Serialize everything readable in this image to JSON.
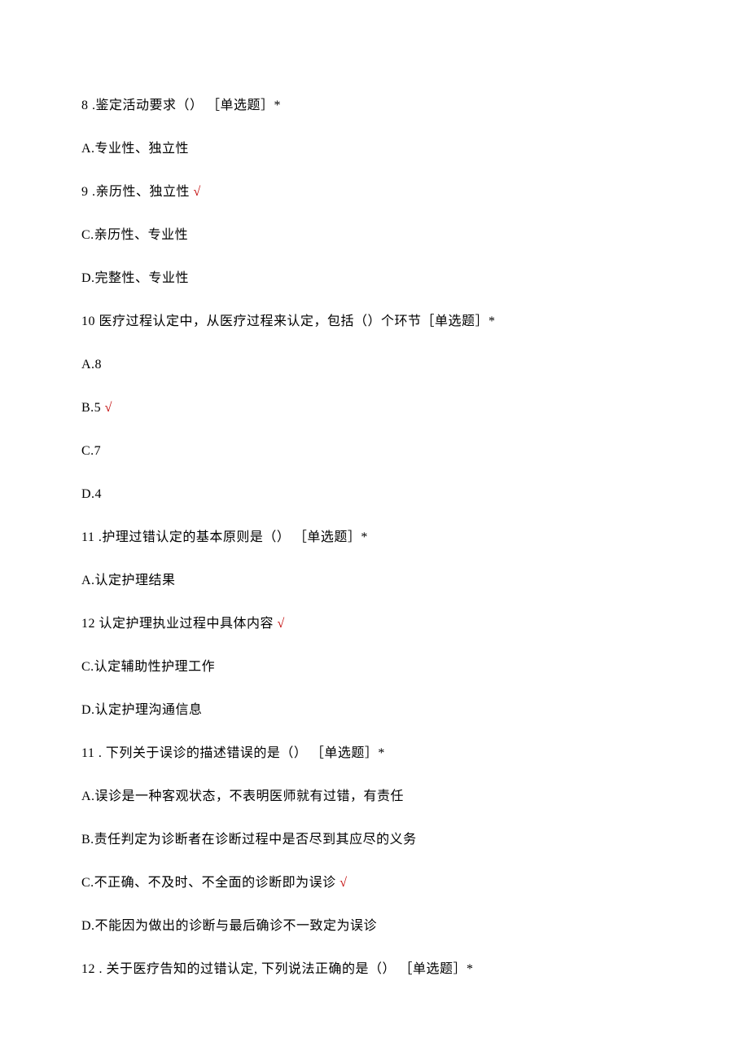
{
  "questions": [
    {
      "number": "8",
      "suffix": "   .鉴定活动要求（） ［单选题］*",
      "options": [
        {
          "label": "A.专业性、独立性",
          "correct": false,
          "prefix": ""
        },
        {
          "label": ".亲历性、独立性",
          "prefix": "9   ",
          "correct": true
        },
        {
          "label": "C.亲历性、专业性",
          "correct": false,
          "prefix": ""
        },
        {
          "label": "D.完整性、专业性",
          "correct": false,
          "prefix": ""
        }
      ]
    },
    {
      "number": "10",
      "suffix": "  医疗过程认定中，从医疗过程来认定，包括（）个环节［单选题］*",
      "options": [
        {
          "label": "A.8",
          "correct": false,
          "prefix": ""
        },
        {
          "label": "B.5",
          "correct": true,
          "prefix": ""
        },
        {
          "label": "C.7",
          "correct": false,
          "prefix": ""
        },
        {
          "label": "D.4",
          "correct": false,
          "prefix": ""
        }
      ]
    },
    {
      "number": "11",
      "suffix": "   .护理过错认定的基本原则是（） ［单选题］*",
      "options": [
        {
          "label": "A.认定护理结果",
          "correct": false,
          "prefix": ""
        },
        {
          "label": "认定护理执业过程中具体内容",
          "prefix": "12  ",
          "correct": true
        },
        {
          "label": "C.认定辅助性护理工作",
          "correct": false,
          "prefix": ""
        },
        {
          "label": "D.认定护理沟通信息",
          "correct": false,
          "prefix": ""
        }
      ]
    },
    {
      "number": "11",
      "suffix": "   . 下列关于误诊的描述错误的是（） ［单选题］*",
      "options": [
        {
          "label": "A.误诊是一种客观状态，不表明医师就有过错，有责任",
          "correct": false,
          "prefix": ""
        },
        {
          "label": "B.责任判定为诊断者在诊断过程中是否尽到其应尽的义务",
          "correct": false,
          "prefix": ""
        },
        {
          "label": "C.不正确、不及时、不全面的诊断即为误诊",
          "correct": true,
          "prefix": ""
        },
        {
          "label": "D.不能因为做出的诊断与最后确诊不一致定为误诊",
          "correct": false,
          "prefix": ""
        }
      ]
    },
    {
      "number": "12",
      "suffix": "   . 关于医疗告知的过错认定, 下列说法正确的是（） ［单选题］*",
      "options": []
    }
  ],
  "checkmark": " √"
}
